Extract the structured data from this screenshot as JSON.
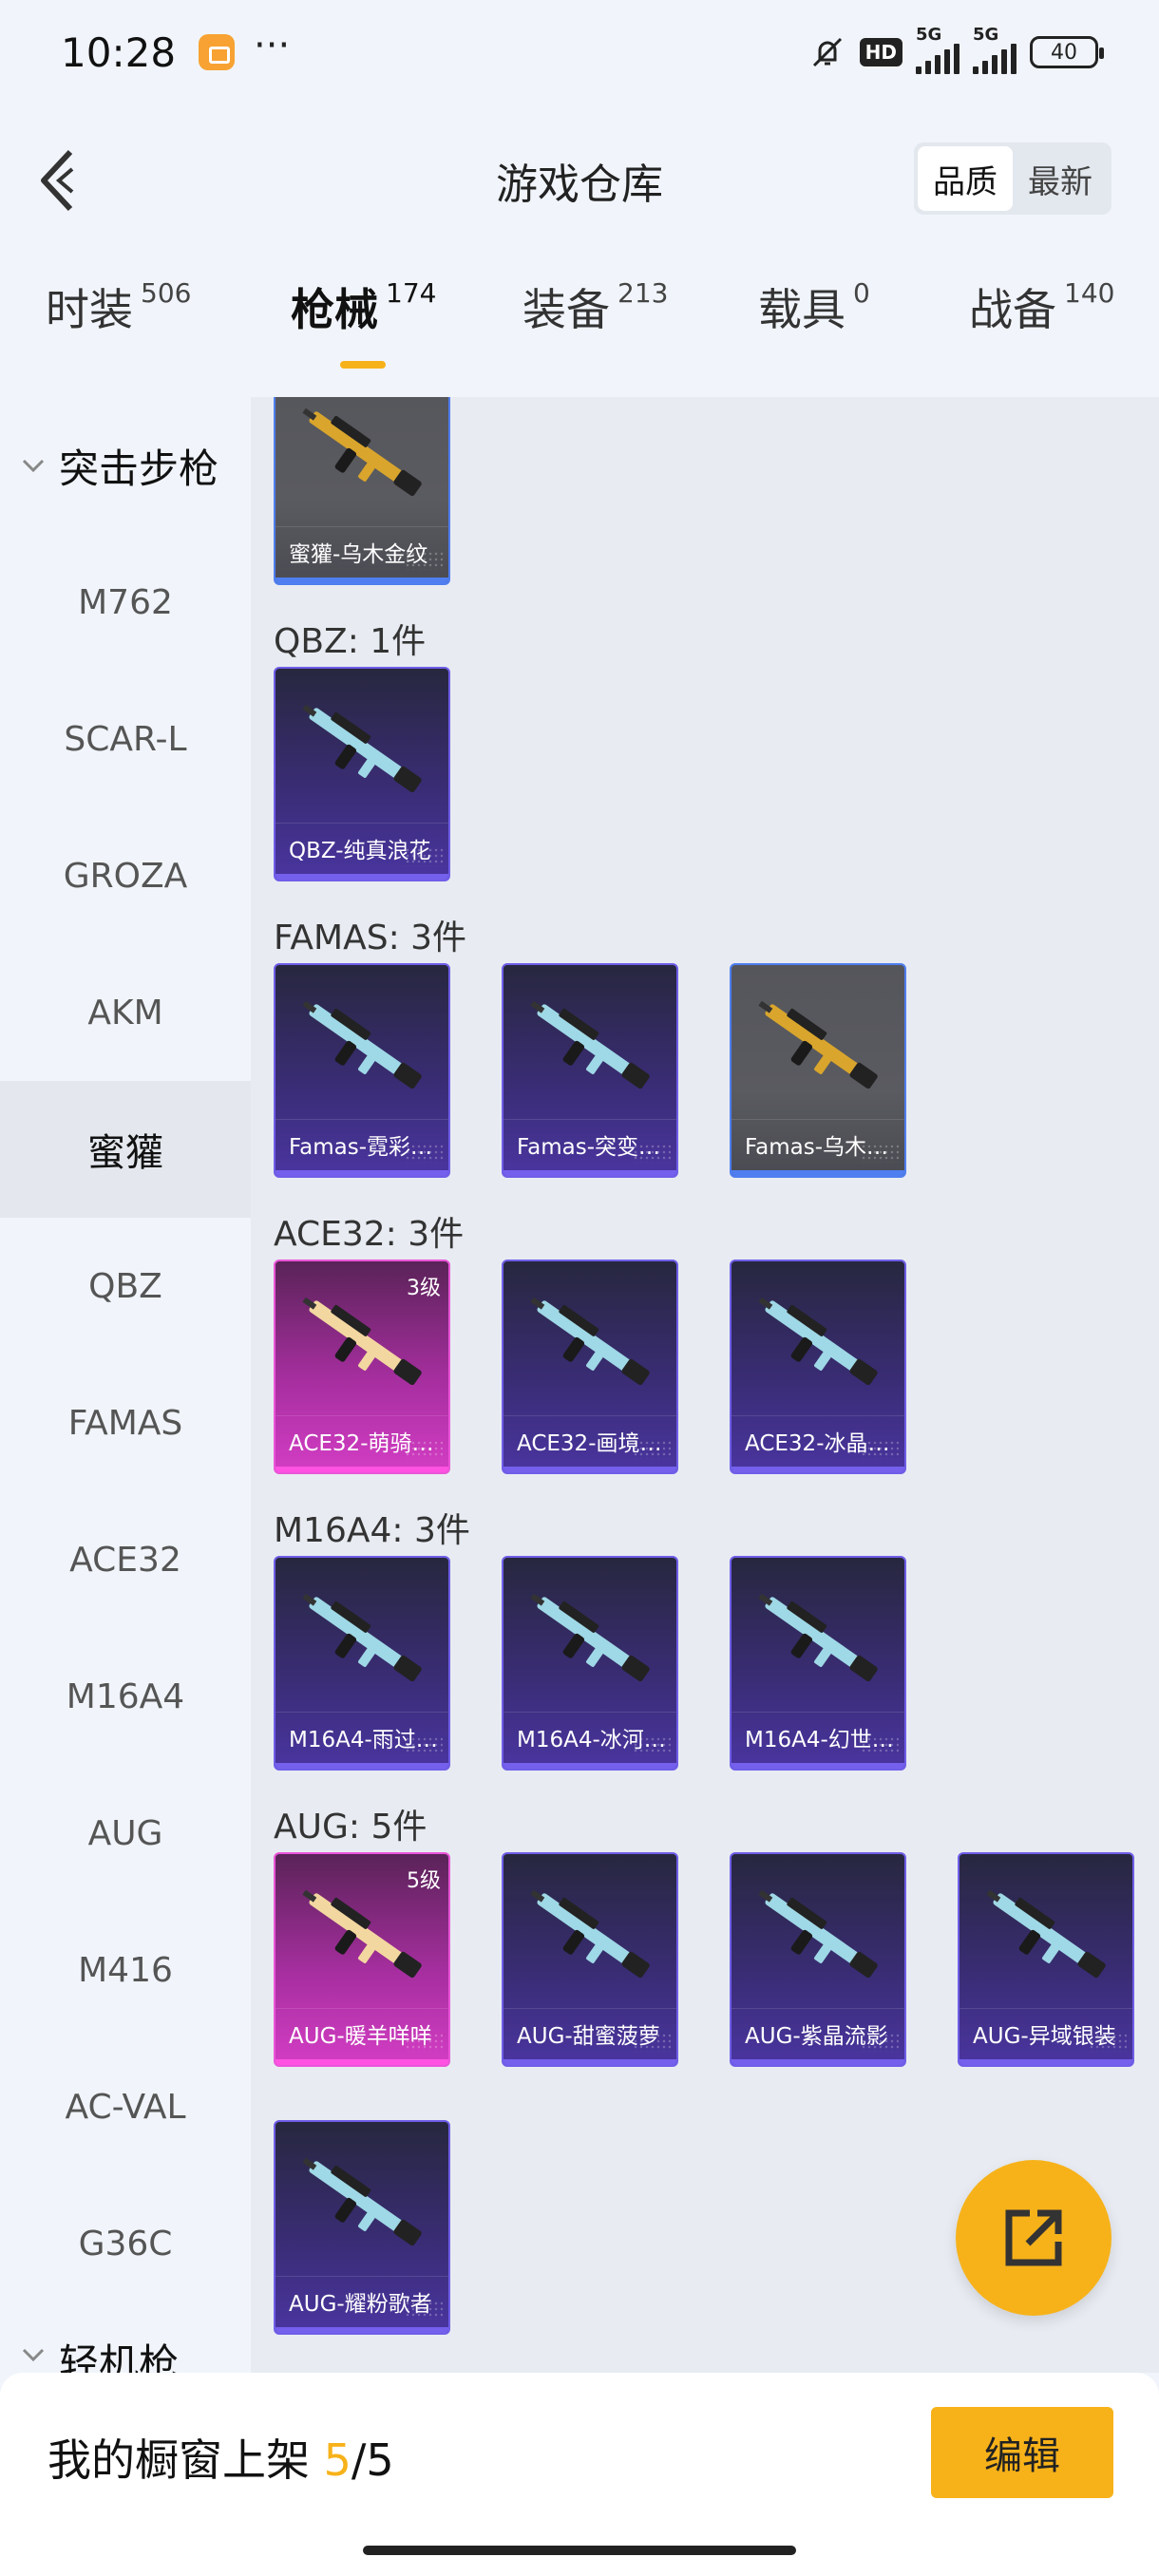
{
  "status_bar": {
    "time": "10:28",
    "dots": "···",
    "hd_label": "HD",
    "signal1_label": "5G",
    "signal2_label": "5G",
    "battery": "40"
  },
  "header": {
    "title": "游戏仓库",
    "sort_options": [
      "品质",
      "最新"
    ],
    "sort_selected": "品质"
  },
  "tabs": [
    {
      "label": "时装",
      "count": "506"
    },
    {
      "label": "枪械",
      "count": "174"
    },
    {
      "label": "装备",
      "count": "213"
    },
    {
      "label": "载具",
      "count": "0"
    },
    {
      "label": "战备",
      "count": "140"
    }
  ],
  "active_tab": "枪械",
  "sidebar": {
    "category": "突击步枪",
    "items": [
      "M762",
      "SCAR-L",
      "GROZA",
      "AKM",
      "蜜獾",
      "QBZ",
      "FAMAS",
      "ACE32",
      "M16A4",
      "AUG",
      "M416",
      "AC-VAL",
      "G36C"
    ],
    "active_item": "蜜獾",
    "next_category_partial": "轻机枪"
  },
  "content": {
    "sections": [
      {
        "title": "",
        "items": [
          {
            "name": "蜜獾-乌木金纹",
            "style": "gray",
            "level": ""
          }
        ]
      },
      {
        "title": "QBZ: 1件",
        "items": [
          {
            "name": "QBZ-纯真浪花",
            "style": "purple",
            "level": ""
          }
        ]
      },
      {
        "title": "FAMAS: 3件",
        "items": [
          {
            "name": "Famas-霓彩…",
            "style": "purple",
            "level": ""
          },
          {
            "name": "Famas-突变…",
            "style": "purple",
            "level": ""
          },
          {
            "name": "Famas-乌木…",
            "style": "gray",
            "level": ""
          }
        ]
      },
      {
        "title": "ACE32: 3件",
        "items": [
          {
            "name": "ACE32-萌骑…",
            "style": "pink",
            "level": "3级"
          },
          {
            "name": "ACE32-画境…",
            "style": "purple",
            "level": ""
          },
          {
            "name": "ACE32-冰晶…",
            "style": "purple",
            "level": ""
          }
        ]
      },
      {
        "title": "M16A4: 3件",
        "items": [
          {
            "name": "M16A4-雨过…",
            "style": "purple",
            "level": ""
          },
          {
            "name": "M16A4-冰河…",
            "style": "purple",
            "level": ""
          },
          {
            "name": "M16A4-幻世…",
            "style": "purple",
            "level": ""
          }
        ]
      },
      {
        "title": "AUG: 5件",
        "items": [
          {
            "name": "AUG-暖羊咩咩",
            "style": "pink",
            "level": "5级"
          },
          {
            "name": "AUG-甜蜜菠萝",
            "style": "purple",
            "level": ""
          },
          {
            "name": "AUG-紫晶流影",
            "style": "purple",
            "level": ""
          },
          {
            "name": "AUG-异域银装",
            "style": "purple",
            "level": ""
          },
          {
            "name": "AUG-耀粉歌者",
            "style": "purple",
            "level": ""
          }
        ]
      }
    ],
    "gun_colors": {
      "gray": "#d9a52c",
      "purple": "#9fd8e6",
      "pink": "#f3d7a0"
    }
  },
  "bottom_bar": {
    "showcase_label": "我的橱窗上架",
    "showcase_count": "5",
    "showcase_total": "/5",
    "edit_label": "编辑"
  },
  "icons": {
    "back": "chevron-left-icon",
    "share": "share-external-icon",
    "mute": "bell-mute-icon"
  },
  "colors": {
    "accent": "#f7b21a",
    "active_sidebar_bg": "#e4e8ee",
    "content_bg": "#e8ecf2"
  }
}
